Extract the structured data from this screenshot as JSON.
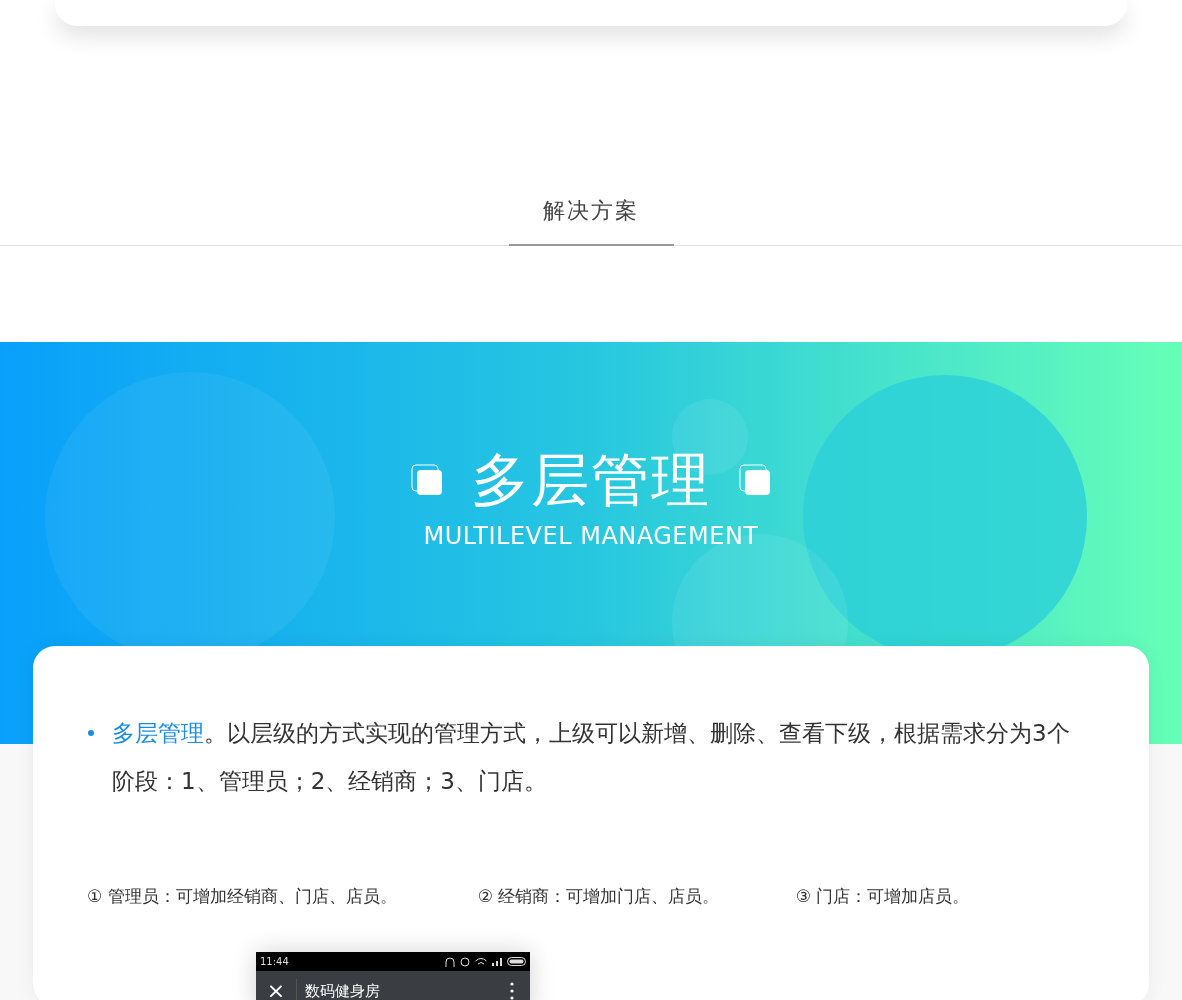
{
  "section_tab": {
    "label": "解决方案",
    "selected": true
  },
  "banner": {
    "title": "多层管理",
    "subtitle": "MULTILEVEL MANAGEMENT"
  },
  "intro": {
    "highlight": "多层管理",
    "text": "。以层级的方式实现的管理方式，上级可以新增、删除、查看下级，根据需求分为3个阶段：1、管理员；2、经销商；3、门店。"
  },
  "levels": [
    {
      "mark": "①",
      "text": "管理员：可增加经销商、门店、店员。"
    },
    {
      "mark": "②",
      "text": "经销商：可增加门店、店员。"
    },
    {
      "mark": "③",
      "text": "门店：可增加店员。"
    }
  ],
  "phone": {
    "time": "11:44",
    "close": "×",
    "title": "数码健身房"
  }
}
